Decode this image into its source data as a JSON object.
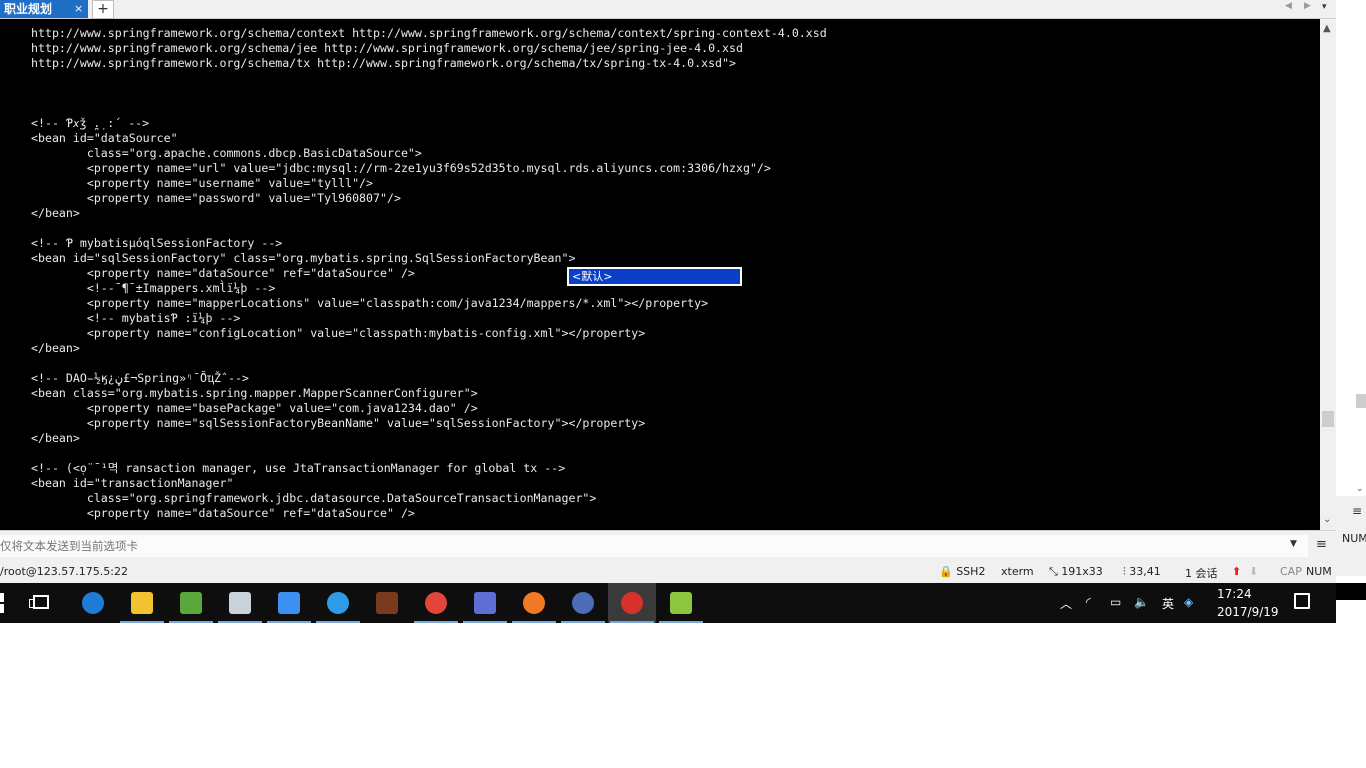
{
  "tabs": {
    "active_label": "职业规划",
    "close_glyph": "×",
    "new_tab_glyph": "+",
    "nav_left_glyph": "◀",
    "nav_right_glyph": "▶",
    "menu_glyph": "▾"
  },
  "terminal": {
    "lines": [
      "http://www.springframework.org/schema/context http://www.springframework.org/schema/context/spring-context-4.0.xsd",
      "http://www.springframework.org/schema/jee http://www.springframework.org/schema/jee/spring-jee-4.0.xsd",
      "http://www.springframework.org/schema/tx http://www.springframework.org/schema/tx/spring-tx-4.0.xsd\">",
      "",
      "",
      "",
      "<!-- Ƥ𝑥ǯ ̪.̣ :´ -->",
      "<bean id=\"dataSource\"",
      "        class=\"org.apache.commons.dbcp.BasicDataSource\">",
      "        <property name=\"url\" value=\"jdbc:mysql://rm-2ze1yu3f69s52d35to.mysql.rds.aliyuncs.com:3306/hzxg\"/>",
      "        <property name=\"username\" value=\"tylll\"/>",
      "        <property name=\"password\" value=\"Tyl960807\"/>",
      "</bean>",
      "",
      "<!-- Ƥ mybatisµóqlSessionFactory -->",
      "<bean id=\"sqlSessionFactory\" class=\"org.mybatis.spring.SqlSessionFactoryBean\">",
      "        <property name=\"dataSource\" ref=\"dataSource\" />",
      "        <!--̄ ¶¯±Imappers.xml̀ï¼þ -->",
      "        <property name=\"mapperLocations\" value=\"classpath:com/java1234/mappers/*.xml\"></property>",
      "        <!-- mybatisƤ :ï¼þ -->",
      "        <property name=\"configLocation\" value=\"classpath:mybatis-config.xml\"></property>",
      "</bean>",
      "",
      "<!-- DAO̵½ӄ¿ڼ£¬Spring»ᶯ¯̄ÕҵŽ̂ -->",
      "<bean class=\"org.mybatis.spring.mapper.MapperScannerConfigurer\">",
      "        <property name=\"basePackage\" value=\"com.java1234.dao\" />",
      "        <property name=\"sqlSessionFactoryBeanName\" value=\"sqlSessionFactory\"></property>",
      "</bean>",
      "",
      "<!-- (<ọ̈ ̄ ¹멱 ransaction manager, use JtaTransactionManager for global tx -->",
      "<bean id=\"transactionManager\"",
      "        class=\"org.springframework.jdbc.datasource.DataSourceTransactionManager\">",
      "        <property name=\"dataSource\" ref=\"dataSource\" />"
    ],
    "ime_candidate": "<默认>"
  },
  "send_bar": {
    "placeholder": "仅将文本发送到当前选项卡",
    "dropdown_glyph": "▼",
    "menu_glyph": "≡"
  },
  "status_bar": {
    "host": "/root@123.57.175.5:22",
    "protocol": "SSH2",
    "terminal_type": "xterm",
    "size": "191x33",
    "cursor": "33,41",
    "sessions": "1 会话",
    "upload_glyph": "⬆",
    "download_glyph": "⬇",
    "cap": "CAP",
    "num": "NUM"
  },
  "right_strip": {
    "num": "NUM",
    "menu_glyph": "≡",
    "down_glyph": "⌄",
    "arrow_glyph": "⌄"
  },
  "taskbar": {
    "apps": [
      {
        "name": "edge-icon",
        "color": "#1e7bd8"
      },
      {
        "name": "file-explorer-icon",
        "color": "#f2c231"
      },
      {
        "name": "notepad-icon",
        "color": "#5aa83c"
      },
      {
        "name": "paint-icon",
        "color": "#c9d1d9"
      },
      {
        "name": "baidu-netdisk-icon",
        "color": "#3d8ff0"
      },
      {
        "name": "ie-icon",
        "color": "#2f9be8"
      },
      {
        "name": "game-icon",
        "color": "#7a3b1c"
      },
      {
        "name": "chrome-icon",
        "color": "#e4453a"
      },
      {
        "name": "dolphin-icon",
        "color": "#5d6fd6"
      },
      {
        "name": "firefox-icon",
        "color": "#f07a23"
      },
      {
        "name": "globe-icon",
        "color": "#4b6cb7"
      },
      {
        "name": "xshell-icon",
        "color": "#d8312b"
      },
      {
        "name": "cube-app-icon",
        "color": "#8cc63f"
      }
    ],
    "tray": {
      "chevron_glyph": "︿",
      "wifi_glyph": "◜",
      "battery_glyph": "▭",
      "volume_glyph": "🔈",
      "ime": "英",
      "shield_glyph": "◈"
    },
    "time": "17:24",
    "date": "2017/9/19"
  }
}
